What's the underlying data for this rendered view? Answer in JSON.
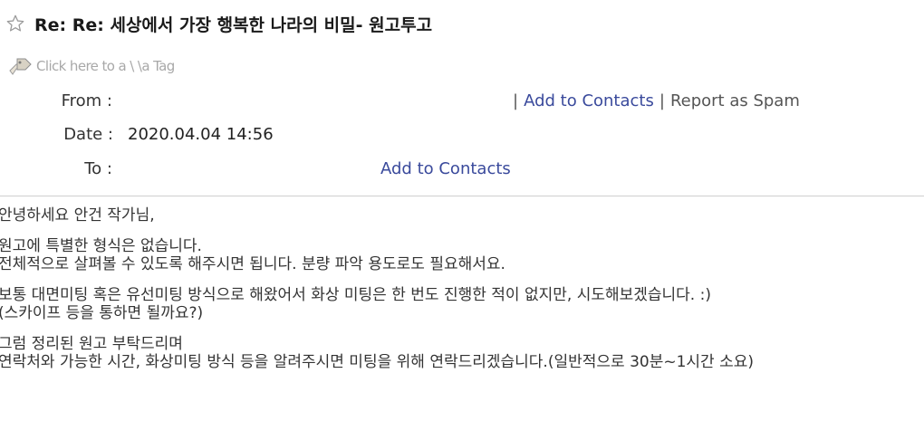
{
  "subject": "Re: Re: 세상에서 가장 행복한 나라의 비밀- 원고투고",
  "tag_link": "Click here to a \\ \\a Tag",
  "headers": {
    "from_label": "From :",
    "date_label": "Date :",
    "date_value": "2020.04.04 14:56",
    "to_label": "To :",
    "add_to_contacts": "Add to Contacts",
    "report_spam": "Report as Spam",
    "separator": "|"
  },
  "body": {
    "paragraphs": [
      [
        "안녕하세요 안건 작가님,"
      ],
      [
        "원고에 특별한 형식은 없습니다.",
        "전체적으로 살펴볼 수 있도록 해주시면 됩니다. 분량 파악 용도로도 필요해서요."
      ],
      [
        "보통 대면미팅 혹은 유선미팅 방식으로 해왔어서 화상 미팅은 한 번도 진행한 적이 없지만, 시도해보겠습니다. :)",
        "(스카이프 등을 통하면 될까요?)"
      ],
      [
        "그럼 정리된 원고 부탁드리며",
        "연락처와 가능한 시간, 화상미팅 방식 등을 알려주시면 미팅을 위해 연락드리겠습니다.(일반적으로 30분~1시간 소요)"
      ]
    ]
  },
  "icons": {
    "star": "star-outline-icon",
    "tag": "tag-hand-icon"
  },
  "colors": {
    "link": "#3a4a9c",
    "text": "#333333",
    "divider": "#cfcfcf"
  }
}
